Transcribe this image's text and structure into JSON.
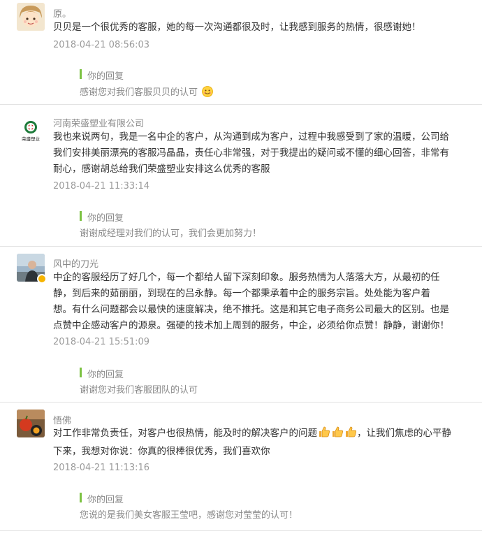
{
  "comments": [
    {
      "user": "原。",
      "lines": [
        "贝贝是一个很优秀的客服，她的每一次沟通都很及时，让我感到服务的热情，很感谢她！"
      ],
      "time": "2018-04-21 08:56:03",
      "reply_label": "你的回复",
      "reply_text": "感谢您对我们客服贝贝的认可",
      "avatar_icon": "cartoon-face-avatar"
    },
    {
      "user": "河南荣盛塑业有限公司",
      "lines": [
        "我也来说两句，我是一名中企的客户，从沟通到成为客户，过程中我感受到了家的温暖，公司给",
        "我们安排美丽漂亮的客服冯晶晶，责任心非常强，对于我提出的疑问或不懂的细心回答，非常有",
        "耐心，感谢胡总给我们荣盛塑业安排这么优秀的客服"
      ],
      "time": "2018-04-21 11:33:14",
      "reply_label": "你的回复",
      "reply_text": "谢谢成经理对我们的认可，我们会更加努力！",
      "avatar_icon": "company-logo-avatar",
      "logo_caption": "荣盛塑业"
    },
    {
      "user": "风中的刀光",
      "lines": [
        "中企的客服经历了好几个，每一个都给人留下深刻印象。服务热情为人落落大方，从最初的任",
        "静，到后来的茹丽丽，到现在的吕永静。每一个都秉承着中企的服务宗旨。处处能为客户着",
        "想。有什么问题都会以最快的速度解决，绝不推托。这是和其它电子商务公司最大的区别。也是",
        "点赞中企感动客户的源泉。强硬的技术加上周到的服务，中企，必须给你点赞！静静，谢谢你！"
      ],
      "time": "2018-04-21 15:51:09",
      "reply_label": "你的回复",
      "reply_text": "谢谢您对我们客服团队的认可",
      "avatar_icon": "photo-avatar"
    },
    {
      "user": "悟佛",
      "lines": [
        "对工作非常负责任，对客户也很热情，能及时的解决客户的问题",
        "下来，我想对你说：你真的很棒很优秀，我们喜欢你"
      ],
      "line1_suffix": "，让我们焦虑的心平静",
      "time": "2018-04-21 11:13:16",
      "reply_label": "你的回复",
      "reply_text": "您说的是我们美女客服王莹吧，感谢您对莹莹的认可！",
      "avatar_icon": "fruit-photo-avatar"
    }
  ],
  "colors": {
    "accent_bar": "#7cc243",
    "muted_text": "#8a8a8a",
    "body_text": "#333333",
    "divider": "#e3e3e3"
  }
}
